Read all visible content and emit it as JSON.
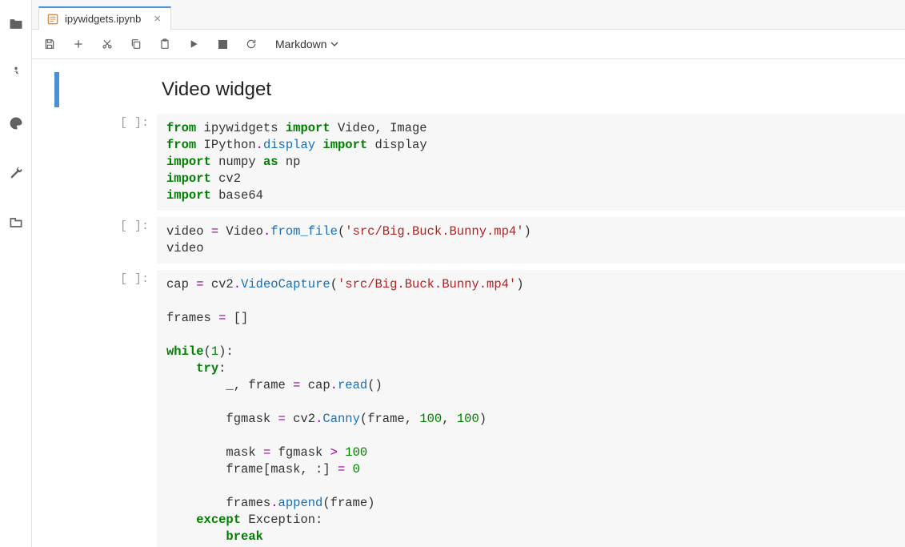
{
  "tab": {
    "title": "ipywidgets.ipynb"
  },
  "toolbar": {
    "cell_type": "Markdown"
  },
  "markdown": {
    "heading": "Video widget"
  },
  "prompts": {
    "code": "[ ]:"
  },
  "code1": {
    "l1_from": "from",
    "l1_t1": " ipywidgets ",
    "l1_import": "import",
    "l1_t2": " Video, Image",
    "l2_from": "from",
    "l2_t1": " IPython",
    "l2_dot": ".",
    "l2_disp": "display",
    "l2_sp": " ",
    "l2_import": "import",
    "l2_t2": " display",
    "l3_import": "import",
    "l3_t1": " numpy ",
    "l3_as": "as",
    "l3_t2": " np",
    "l4_import": "import",
    "l4_t1": " cv2",
    "l5_import": "import",
    "l5_t1": " base64"
  },
  "code2": {
    "l1_a": "video ",
    "l1_eq": "=",
    "l1_b": " Video",
    "l1_dot": ".",
    "l1_fn": "from_file",
    "l1_c": "(",
    "l1_str": "'src/Big.Buck.Bunny.mp4'",
    "l1_d": ")",
    "l2": "video"
  },
  "code3": {
    "l1_a": "cap ",
    "l1_eq": "=",
    "l1_b": " cv2",
    "l1_dot": ".",
    "l1_fn": "VideoCapture",
    "l1_c": "(",
    "l1_str": "'src/Big.Buck.Bunny.mp4'",
    "l1_d": ")",
    "l3_a": "frames ",
    "l3_eq": "=",
    "l3_b": " []",
    "l5_while": "while",
    "l5_a": "(",
    "l5_num": "1",
    "l5_b": "):",
    "l6_pad": "    ",
    "l6_try": "try",
    "l6_a": ":",
    "l7_pad": "        ",
    "l7_a": "_, frame ",
    "l7_eq": "=",
    "l7_b": " cap",
    "l7_dot": ".",
    "l7_fn": "read",
    "l7_c": "()",
    "l9_pad": "        ",
    "l9_a": "fgmask ",
    "l9_eq": "=",
    "l9_b": " cv2",
    "l9_dot": ".",
    "l9_fn": "Canny",
    "l9_c": "(frame, ",
    "l9_n1": "100",
    "l9_d": ", ",
    "l9_n2": "100",
    "l9_e": ")",
    "l11_pad": "        ",
    "l11_a": "mask ",
    "l11_eq": "=",
    "l11_b": " fgmask ",
    "l11_gt": ">",
    "l11_sp": " ",
    "l11_n": "100",
    "l12_pad": "        ",
    "l12_a": "frame[mask, :] ",
    "l12_eq": "=",
    "l12_sp": " ",
    "l12_n": "0",
    "l14_pad": "        ",
    "l14_a": "frames",
    "l14_dot": ".",
    "l14_fn": "append",
    "l14_b": "(frame)",
    "l15_pad": "    ",
    "l15_except": "except",
    "l15_a": " Exception:",
    "l16_pad": "        ",
    "l16_break": "break"
  }
}
